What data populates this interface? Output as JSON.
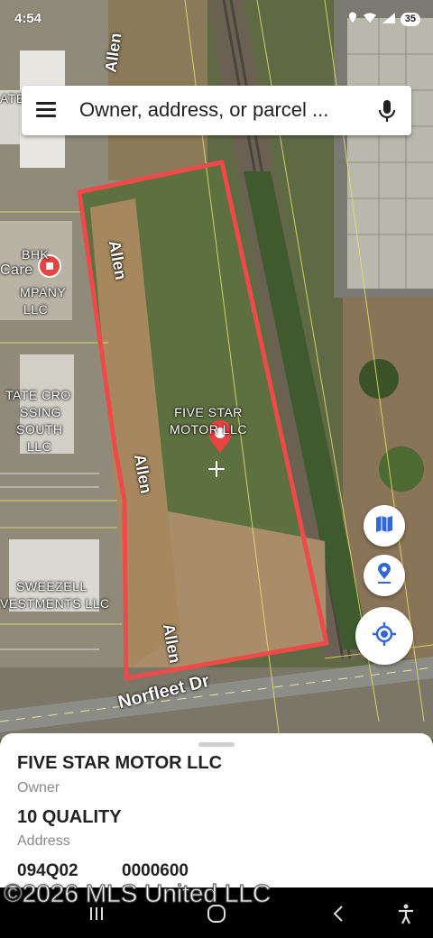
{
  "status_bar": {
    "time": "4:54",
    "battery": "35"
  },
  "search": {
    "placeholder": "Owner, address, or parcel ..."
  },
  "map": {
    "parcel_owner_label": "FIVE STAR MOTOR LLC",
    "road_labels": [
      "Allen",
      "Allen",
      "Allen",
      "Allen",
      "Allen",
      "Norfleet Dr"
    ],
    "place_labels": {
      "bhk": "BHK",
      "care": "Care",
      "company": "MPANY",
      "llc1": "LLC",
      "tate1": "TATE CRO",
      "tate2": "SSING",
      "tate3": "SOUTH",
      "tate4": "LLC",
      "sweezell1": "SWEEZELL",
      "sweezell2": "VESTMENTS LLC",
      "tate_top": "ATE"
    },
    "parcel_outline_color": "#ee4a4a"
  },
  "sheet": {
    "owner_name": "FIVE STAR MOTOR LLC",
    "owner_label": "Owner",
    "address_value": "10 QUALITY",
    "address_label": "Address",
    "parcel_id_a": "094Q02",
    "parcel_id_b": "0000600"
  },
  "watermark": "©2026 MLS United LLC",
  "icons": [
    "menu-icon",
    "mic-icon",
    "map-layers-icon",
    "pin-icon",
    "locate-icon",
    "recents-icon",
    "home-icon",
    "back-icon",
    "accessibility-icon"
  ]
}
